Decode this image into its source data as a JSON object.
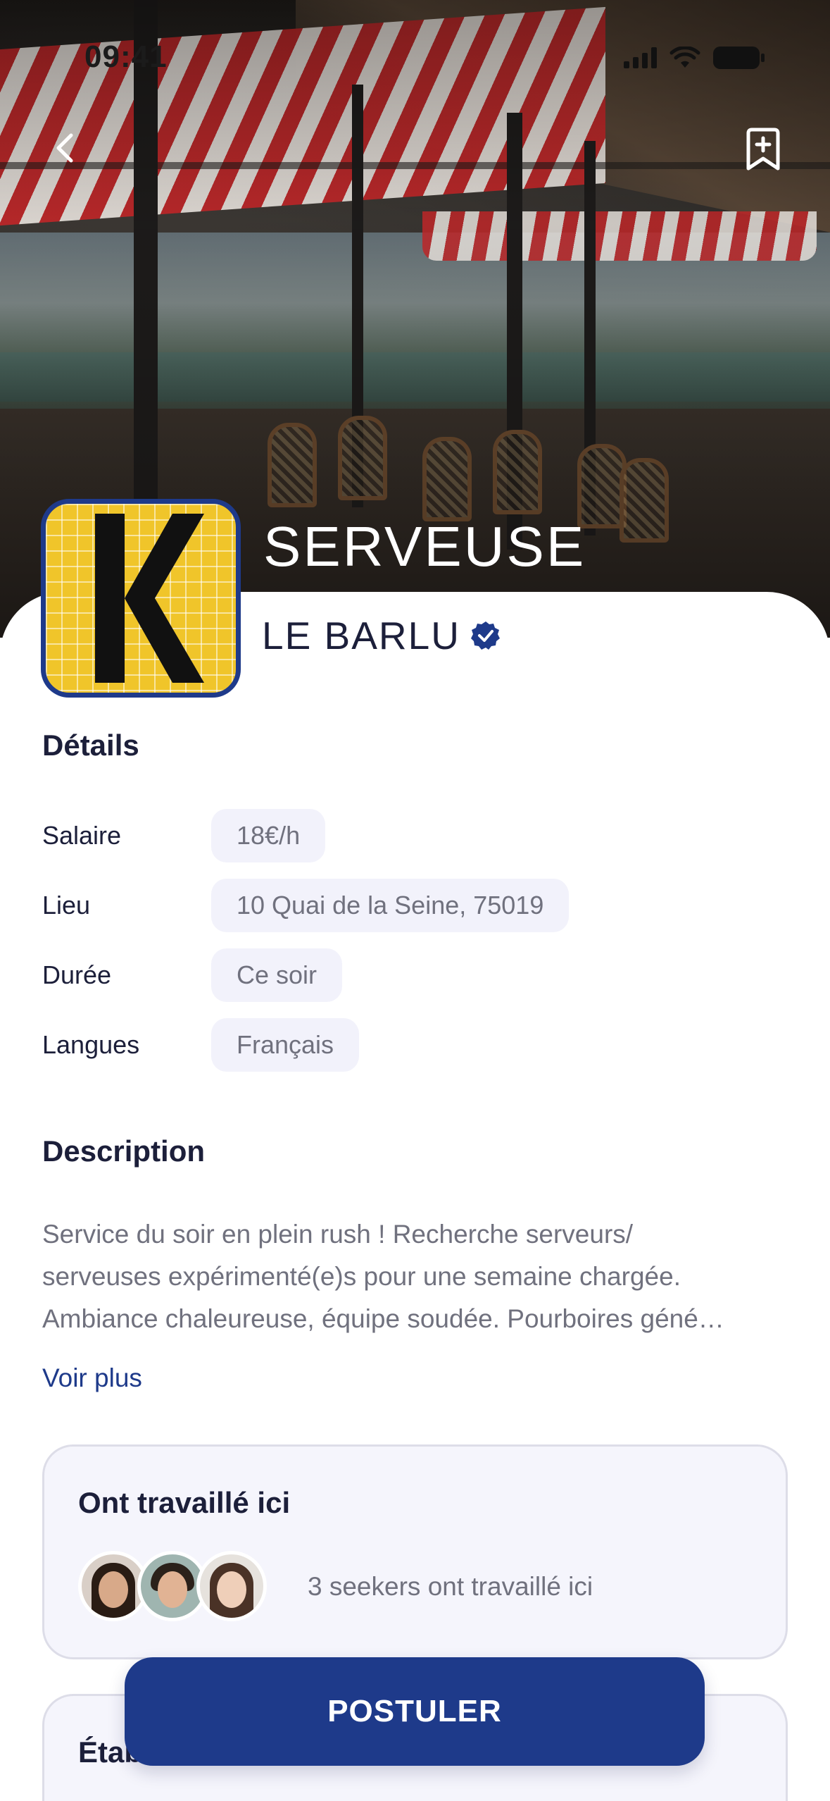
{
  "status_bar": {
    "time": "09:41"
  },
  "header": {
    "back_icon": "chevron-left-icon",
    "bookmark_icon": "bookmark-plus-icon"
  },
  "job": {
    "title": "SERVEUSE",
    "company": "LE BARLU",
    "verified": true
  },
  "details": {
    "title": "Détails",
    "rows": [
      {
        "label": "Salaire",
        "value": "18€/h"
      },
      {
        "label": "Lieu",
        "value": "10 Quai de la Seine, 75019"
      },
      {
        "label": "Durée",
        "value": "Ce soir"
      },
      {
        "label": "Langues",
        "value": "Français"
      }
    ]
  },
  "description": {
    "title": "Description",
    "lines": [
      "Service du soir en plein rush ! Recherche serveurs/",
      "serveuses expérimenté(e)s pour une semaine chargée.",
      "Ambiance chaleureuse, équipe soudée. Pourboires géné…"
    ],
    "see_more": "Voir plus"
  },
  "worked_here": {
    "title": "Ont travaillé ici",
    "text": "3 seekers ont travaillé ici"
  },
  "establishment": {
    "title": "Établissement"
  },
  "cta": {
    "label": "POSTULER"
  },
  "colors": {
    "primary": "#1e3a8a",
    "chip_bg": "#f2f2fb",
    "muted_text": "#70717e",
    "dark_text": "#1c1f3a",
    "logo_yellow": "#f0c52a"
  }
}
